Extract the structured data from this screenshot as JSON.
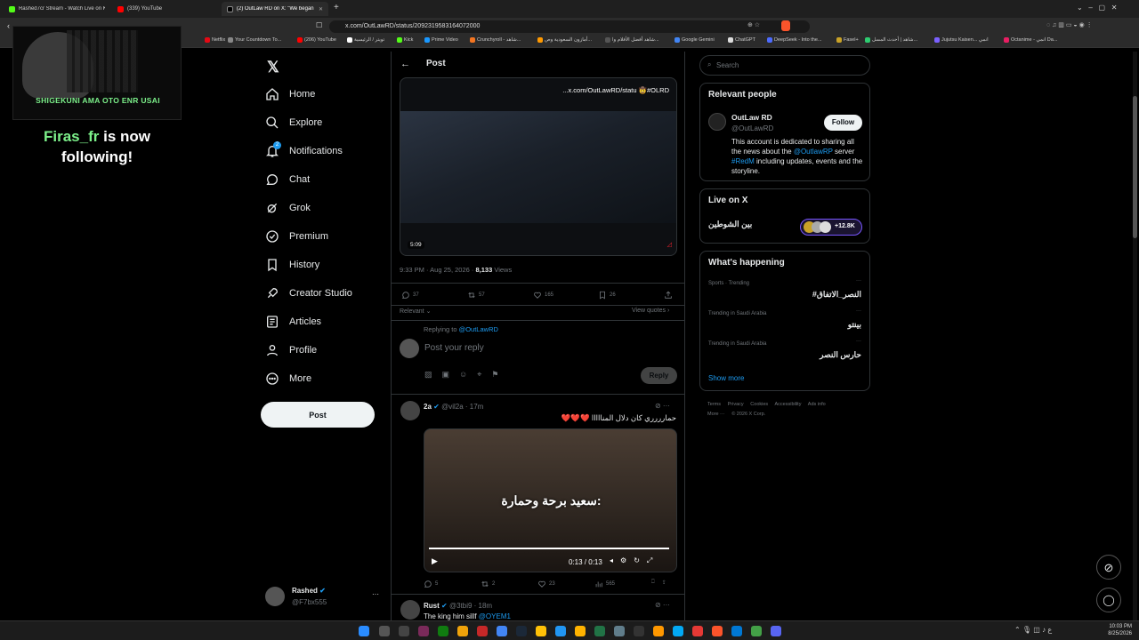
{
  "browser": {
    "tabs": [
      {
        "label": "Rashed7cr Stream - Watch Live on K"
      },
      {
        "label": "(339) YouTube"
      },
      {
        "label": "(2) OutLaw RD on X: \"We began"
      }
    ],
    "new_tab": "+",
    "url": "x.com/OutLawRD/status/2092319583164072000",
    "bookmarks": [
      "Netflix",
      "Your Countdown To...",
      "(206) YouTube",
      "تويتر / الرئيسية",
      "Kick",
      "Prime Video",
      "Crunchyroll - شاهد...",
      "أمازون السعودية وص...",
      "شاهد أفضل الأفلام وا...",
      "Google Gemini",
      "ChatGPT",
      "DeepSeek - Into the...",
      "Fasel+",
      "شاهد | أحدث المسل...",
      "Jujutsu Kaisen... انمي",
      "Octanime - انمي Da..."
    ]
  },
  "overlay": {
    "banner_text": "SHIGEKUNI  AMA  OTO  ENR  USAI",
    "follower_name": "Firas_fr",
    "follow_text": " is now following!"
  },
  "nav": {
    "items": [
      "Home",
      "Explore",
      "Notifications",
      "Chat",
      "Grok",
      "Premium",
      "History",
      "Creator Studio",
      "Articles",
      "Profile",
      "More"
    ],
    "notification_badge": "2",
    "post_button": "Post",
    "account_name": "Rashed",
    "account_handle": "@F7bx555",
    "account_more": "···"
  },
  "main": {
    "header": "Post",
    "video": {
      "caption": "...x.com/OutLawRD/statu 🤠#OLRD",
      "duration": "5:09"
    },
    "meta": {
      "time": "9:33 PM · Aug 25, 2026 · ",
      "views_count": "8,133",
      "views_label": " Views"
    },
    "actions": {
      "replies": "37",
      "reposts": "57",
      "likes": "165",
      "bookmarks": "26"
    },
    "sort_label": "Relevant",
    "view_quotes": "View quotes",
    "replying_to": "Replying to ",
    "replying_handle": "@OutLawRD",
    "reply_placeholder": "Post your reply",
    "reply_button": "Reply",
    "reply1": {
      "name": "2a",
      "handle": "@vil2a · 17m",
      "text": "حمارررري كان دلال المنااااا ❤️❤️❤️",
      "subtitle": "سعيد برحة وحمارة:",
      "time": "0:13 / 0:13",
      "replies": "5",
      "reposts": "2",
      "likes": "23",
      "views": "565"
    },
    "reply2": {
      "name": "Rust",
      "handle": "@3tbi9 · 18m",
      "text": "The king him sillf ",
      "mention": "@OYEM1"
    }
  },
  "right": {
    "search_placeholder": "Search",
    "relevant_title": "Relevant people",
    "person": {
      "name": "OutLaw RD",
      "handle": "@OutLawRD",
      "follow": "Follow",
      "bio1": "This account is dedicated to sharing all the news about the ",
      "bio_link1": "@OutlawRP",
      "bio2": " server ",
      "bio_link2": "#RedM",
      "bio3": " including updates, events and the storyline."
    },
    "live_title": "Live on X",
    "live_name": "بين الشوطين",
    "live_count": "+12.8K",
    "happening_title": "What's happening",
    "trends": [
      {
        "context": "Sports · Trending",
        "name": "#النصر_الاتفاق"
      },
      {
        "context": "Trending in Saudi Arabia",
        "name": "بينتو"
      },
      {
        "context": "Trending in Saudi Arabia",
        "name": "حارس النصر"
      }
    ],
    "show_more": "Show more",
    "footer1": "Terms     Privacy     Cookies     Accessibility     Ads info",
    "footer2": "More ···     © 2026 X Corp."
  },
  "system": {
    "time": "10:03 PM",
    "date": "8/25/2026"
  },
  "colors": {
    "accent": "#1d9bf0",
    "follower": "#7cf08a",
    "like_heart": "#f4212e"
  }
}
